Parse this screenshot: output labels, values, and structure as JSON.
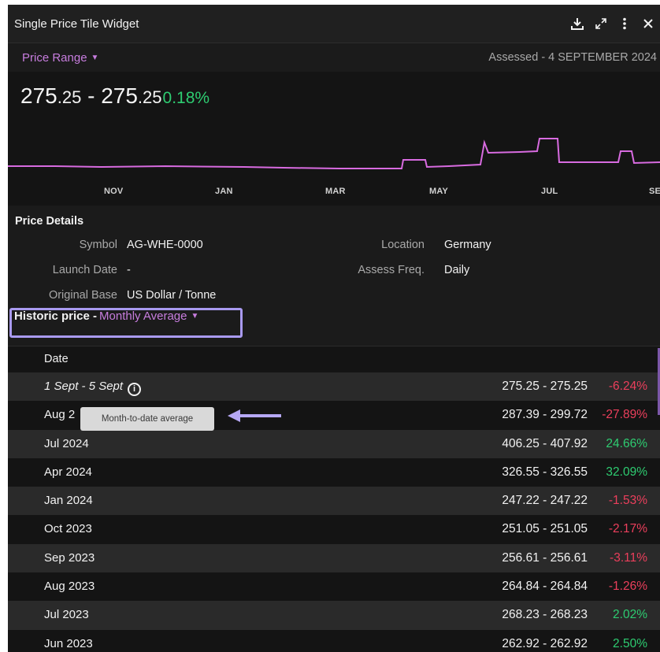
{
  "window": {
    "title": "Single Price Tile Widget",
    "icons": [
      "download-icon",
      "expand-icon",
      "more-vertical-icon",
      "close-icon"
    ]
  },
  "range": {
    "label": "Price Range",
    "assessed": "Assessed - 4 SEPTEMBER 2024"
  },
  "headline": {
    "low_int": "275",
    "low_dec": ".25",
    "separator": " - ",
    "high_int": "275",
    "high_dec": ".25",
    "change": "0.18%"
  },
  "sparkline": {
    "months": [
      "NOV",
      "JAN",
      "MAR",
      "MAY",
      "JUL",
      "SE"
    ],
    "line_color": "#d86be0"
  },
  "details": {
    "title": "Price Details",
    "symbol_label": "Symbol",
    "symbol": "AG-WHE-0000",
    "launch_label": "Launch Date",
    "launch": "-",
    "base_label": "Original Base",
    "base": "US Dollar / Tonne",
    "location_label": "Location",
    "location": "Germany",
    "freq_label": "Assess Freq.",
    "freq": "Daily"
  },
  "historic": {
    "label": "Historic price -",
    "mode": "Monthly Average",
    "column_date": "Date",
    "tooltip": "Month-to-date average",
    "rows": [
      {
        "date": "1 Sept - 5 Sept",
        "range": "275.25 - 275.25",
        "change": "-6.24%",
        "dir": "neg"
      },
      {
        "date": "Aug 2",
        "range": "287.39 - 299.72",
        "change": "-27.89%",
        "dir": "neg"
      },
      {
        "date": "Jul 2024",
        "range": "406.25 - 407.92",
        "change": "24.66%",
        "dir": "pos"
      },
      {
        "date": "Apr 2024",
        "range": "326.55 - 326.55",
        "change": "32.09%",
        "dir": "pos"
      },
      {
        "date": "Jan 2024",
        "range": "247.22 - 247.22",
        "change": "-1.53%",
        "dir": "neg"
      },
      {
        "date": "Oct 2023",
        "range": "251.05 - 251.05",
        "change": "-2.17%",
        "dir": "neg"
      },
      {
        "date": "Sep 2023",
        "range": "256.61 - 256.61",
        "change": "-3.11%",
        "dir": "neg"
      },
      {
        "date": "Aug 2023",
        "range": "264.84 - 264.84",
        "change": "-1.26%",
        "dir": "neg"
      },
      {
        "date": "Jul 2023",
        "range": "268.23 - 268.23",
        "change": "2.02%",
        "dir": "pos"
      },
      {
        "date": "Jun 2023",
        "range": "262.92 - 262.92",
        "change": "2.50%",
        "dir": "pos"
      }
    ]
  },
  "colors": {
    "accent": "#c77dde",
    "positive": "#2ecc71",
    "negative": "#ec3f5c",
    "highlight_box": "#a99af0"
  }
}
